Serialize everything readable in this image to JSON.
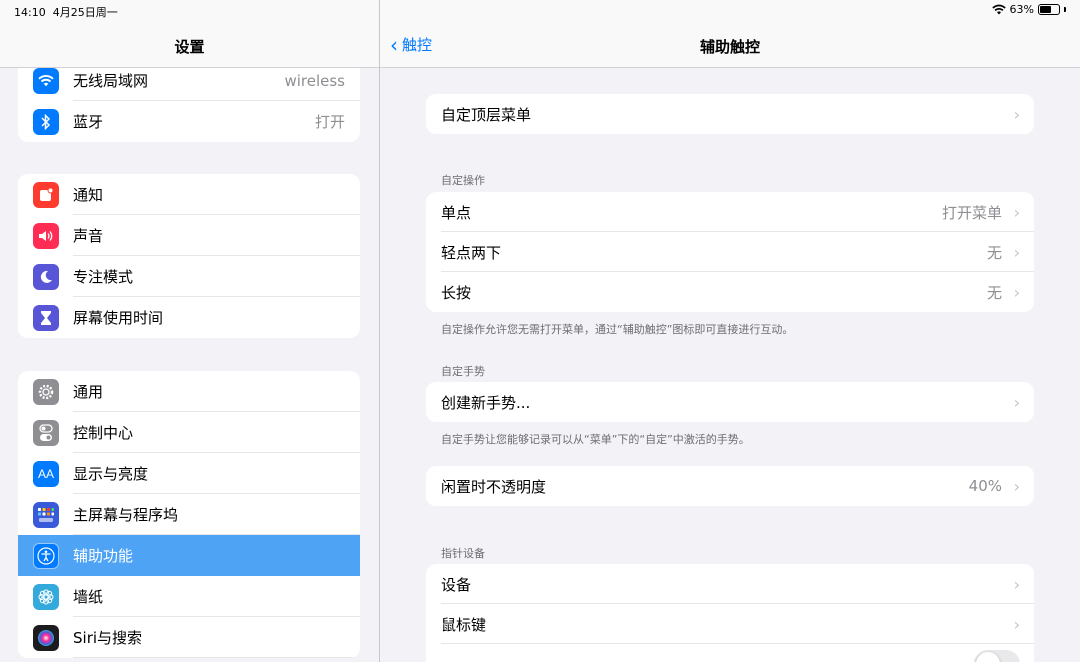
{
  "status_bar": {
    "time": "14:10",
    "date": "4月25日周一",
    "battery": "63%",
    "battery_level": 0.63
  },
  "sidebar": {
    "title": "设置",
    "groups": [
      [
        {
          "label": "无线局域网",
          "value": "wireless",
          "icon": "wifi-icon",
          "color": "#007aff"
        },
        {
          "label": "蓝牙",
          "value": "打开",
          "icon": "bluetooth-icon",
          "color": "#007aff"
        }
      ],
      [
        {
          "label": "通知",
          "value": "",
          "icon": "notification-icon",
          "color": "#ff3b30"
        },
        {
          "label": "声音",
          "value": "",
          "icon": "sound-icon",
          "color": "#ff2d55"
        },
        {
          "label": "专注模式",
          "value": "",
          "icon": "moon-icon",
          "color": "#5856d6"
        },
        {
          "label": "屏幕使用时间",
          "value": "",
          "icon": "hourglass-icon",
          "color": "#5856d6"
        }
      ],
      [
        {
          "label": "通用",
          "value": "",
          "icon": "gear-icon",
          "color": "#8e8e93"
        },
        {
          "label": "控制中心",
          "value": "",
          "icon": "toggles-icon",
          "color": "#8e8e93"
        },
        {
          "label": "显示与亮度",
          "value": "",
          "icon": "aa-icon",
          "color": "#007aff"
        },
        {
          "label": "主屏幕与程序坞",
          "value": "",
          "icon": "grid-icon",
          "color": "#3a5bd9"
        },
        {
          "label": "辅助功能",
          "value": "",
          "icon": "accessibility-icon",
          "color": "#007aff",
          "selected": true
        },
        {
          "label": "墙纸",
          "value": "",
          "icon": "flower-icon",
          "color": "#34aadc"
        },
        {
          "label": "Siri与搜索",
          "value": "",
          "icon": "siri-icon",
          "color": "#222"
        }
      ]
    ]
  },
  "detail": {
    "back_label": "触控",
    "title": "辅助触控",
    "top_menu": {
      "label": "自定顶层菜单"
    },
    "custom_actions": {
      "header": "自定操作",
      "rows": [
        {
          "label": "单点",
          "value": "打开菜单"
        },
        {
          "label": "轻点两下",
          "value": "无"
        },
        {
          "label": "长按",
          "value": "无"
        }
      ],
      "footer": "自定操作允许您无需打开菜单，通过“辅助触控”图标即可直接进行互动。"
    },
    "custom_gestures": {
      "header": "自定手势",
      "rows": [
        {
          "label": "创建新手势..."
        }
      ],
      "footer": "自定手势让您能够记录可以从“菜单”下的“自定”中激活的手势。"
    },
    "idle_opacity": {
      "label": "闲置时不透明度",
      "value": "40%"
    },
    "pointer_devices": {
      "header": "指针设备",
      "rows": [
        {
          "label": "设备"
        },
        {
          "label": "鼠标键"
        }
      ]
    }
  },
  "icons": {
    "chevron": "›",
    "back_chevron": "‹"
  }
}
